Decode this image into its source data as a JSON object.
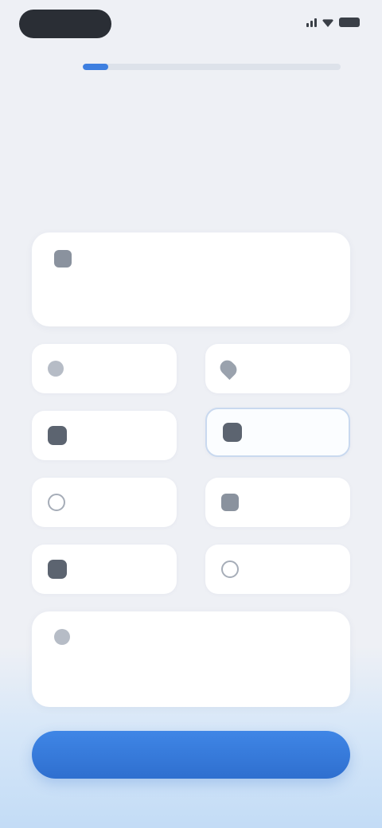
{
  "status_bar": {
    "time": ""
  },
  "onboarding": {
    "progress": 0.1
  },
  "page": {
    "title": ""
  },
  "options": {
    "top_card": {
      "label": "",
      "sublabel": ""
    },
    "tiles": [
      {
        "label": "",
        "icon": "circle-icon",
        "selected": false
      },
      {
        "label": "",
        "icon": "pin-icon",
        "selected": false
      },
      {
        "label": "",
        "icon": "square-icon",
        "selected": false
      },
      {
        "label": "",
        "icon": "square-icon",
        "selected": true
      },
      {
        "label": "",
        "icon": "ring-icon",
        "selected": false
      },
      {
        "label": "",
        "icon": "square-icon",
        "selected": false
      },
      {
        "label": "",
        "icon": "square-icon",
        "selected": false
      },
      {
        "label": "",
        "icon": "ring-icon",
        "selected": false
      }
    ],
    "bottom_card": {
      "label": "",
      "sublabel": ""
    }
  },
  "cta": {
    "label": ""
  },
  "colors": {
    "accent": "#3e7fe0",
    "background": "#eef0f5",
    "card": "#ffffff"
  }
}
